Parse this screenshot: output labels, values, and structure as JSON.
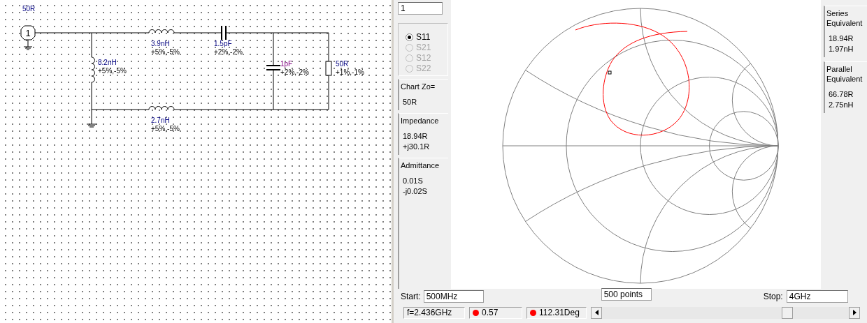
{
  "schematic": {
    "components": [
      {
        "kind": "port",
        "label": "1",
        "value": "50R"
      },
      {
        "kind": "inductor",
        "value": "3.9nH",
        "tolerance": "+5%,-5%"
      },
      {
        "kind": "capacitor",
        "value": "1.5pF",
        "tolerance": "+2%,-2%"
      },
      {
        "kind": "inductor",
        "value": "8.2nH",
        "tolerance": "+5%,-5%"
      },
      {
        "kind": "capacitor",
        "value": "1pF",
        "tolerance": "+2%,-2%"
      },
      {
        "kind": "resistor",
        "value": "50R",
        "tolerance": "+1%,-1%"
      },
      {
        "kind": "inductor",
        "value": "2.7nH",
        "tolerance": "+5%,-5%"
      }
    ]
  },
  "chart_panel": {
    "index_field": "1",
    "parameters": [
      {
        "label": "S11",
        "selected": true,
        "disabled": false
      },
      {
        "label": "S21",
        "selected": false,
        "disabled": true
      },
      {
        "label": "S12",
        "selected": false,
        "disabled": true
      },
      {
        "label": "S22",
        "selected": false,
        "disabled": true
      }
    ],
    "left_boxes": [
      {
        "title": "Chart Zo=",
        "lines": [
          "50R"
        ]
      },
      {
        "title": "Impedance",
        "lines": [
          "18.94R",
          "+j30.1R"
        ]
      },
      {
        "title": "Admittance",
        "lines": [
          "0.01S",
          "-j0.02S"
        ]
      }
    ],
    "right_boxes": [
      {
        "title": "Series Equivalent",
        "lines": [
          "18.94R",
          "1.97nH"
        ]
      },
      {
        "title": "Parallel Equivalent",
        "lines": [
          "66.78R",
          "2.75nH"
        ]
      }
    ],
    "start_label": "Start:",
    "start_value": "500MHz",
    "points_value": "500 points",
    "stop_label": "Stop:",
    "stop_value": "4GHz"
  },
  "status_bar": [
    {
      "kind": "text",
      "text": "f=2.436GHz"
    },
    {
      "kind": "dot",
      "text": "0.57",
      "color": "#ff0000"
    },
    {
      "kind": "dot",
      "text": "112.31Deg",
      "color": "#ff0000"
    }
  ]
}
